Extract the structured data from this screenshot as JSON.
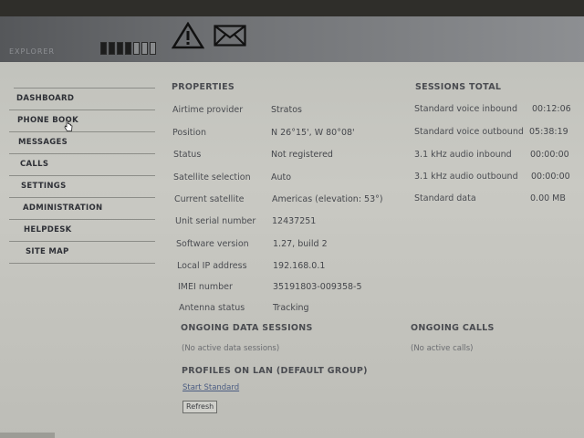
{
  "header": {
    "brand": "EXPLORER",
    "signal_strength": {
      "filled": 4,
      "total": 7
    }
  },
  "sidebar": {
    "items": [
      {
        "label": "DASHBOARD"
      },
      {
        "label": "PHONE BOOK"
      },
      {
        "label": "MESSAGES"
      },
      {
        "label": "CALLS"
      },
      {
        "label": "SETTINGS"
      },
      {
        "label": "ADMINISTRATION"
      },
      {
        "label": "HELPDESK"
      },
      {
        "label": "SITE MAP"
      }
    ]
  },
  "properties": {
    "title": "PROPERTIES",
    "rows": [
      {
        "label": "Airtime provider",
        "value": "Stratos"
      },
      {
        "label": "Position",
        "value": "N 26°15', W 80°08'"
      },
      {
        "label": "Status",
        "value": "Not registered"
      },
      {
        "label": "Satellite selection",
        "value": "Auto"
      },
      {
        "label": "Current satellite",
        "value": "Americas (elevation: 53°)"
      },
      {
        "label": "Unit serial number",
        "value": "12437251"
      },
      {
        "label": "Software version",
        "value": "1.27, build 2"
      },
      {
        "label": "Local IP address",
        "value": "192.168.0.1"
      },
      {
        "label": "IMEI number",
        "value": "35191803-009358-5"
      },
      {
        "label": "Antenna status",
        "value": "Tracking"
      }
    ]
  },
  "sessions_total": {
    "title": "SESSIONS TOTAL",
    "rows": [
      {
        "label": "Standard voice inbound",
        "value": "00:12:06"
      },
      {
        "label": "Standard voice outbound",
        "value": "05:38:19"
      },
      {
        "label": "3.1 kHz audio inbound",
        "value": "00:00:00"
      },
      {
        "label": "3.1 kHz audio outbound",
        "value": "00:00:00"
      },
      {
        "label": "Standard data",
        "value": "0.00 MB"
      }
    ]
  },
  "ongoing_data": {
    "title": "ONGOING DATA SESSIONS",
    "empty_text": "(No active data sessions)"
  },
  "ongoing_calls": {
    "title": "ONGOING CALLS",
    "empty_text": "(No active calls)"
  },
  "profiles": {
    "title": "PROFILES ON LAN (DEFAULT GROUP)",
    "link": "Start Standard",
    "refresh_label": "Refresh"
  }
}
